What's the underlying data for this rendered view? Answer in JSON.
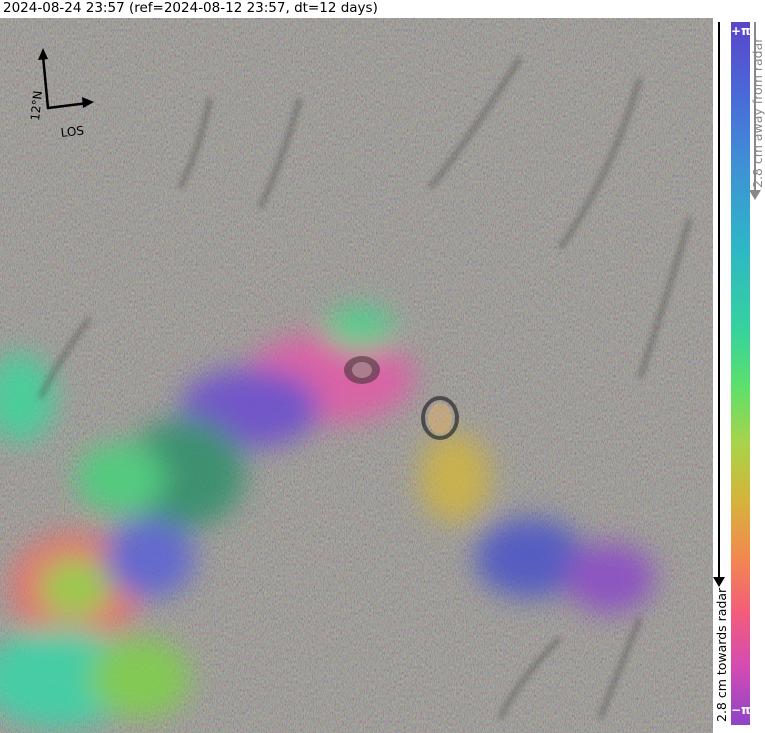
{
  "title": "2024-08-24 23:57 (ref=2024-08-12 23:57, dt=12 days)",
  "orientation": {
    "north_label": "12°N",
    "los_label": "LOS"
  },
  "colorbar": {
    "top_label": "+π",
    "bottom_label": "−π",
    "away_label": "2.8 cm away from radar",
    "towards_label": "2.8 cm towards radar",
    "colors": [
      "#5a45c8",
      "#4a68d8",
      "#3f8fd6",
      "#2eb6c7",
      "#36d39c",
      "#5ee06a",
      "#a9d34a",
      "#d5b43b",
      "#f28a4f",
      "#f35d7a",
      "#d24bb4",
      "#8d44c7"
    ]
  }
}
